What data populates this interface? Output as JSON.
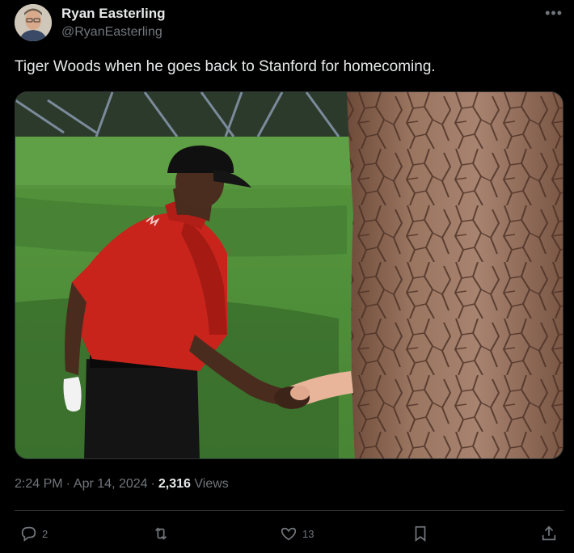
{
  "author": {
    "display_name": "Ryan Easterling",
    "handle": "@RyanEasterling"
  },
  "menu_icon": "more-horizontal-icon",
  "tweet": {
    "text": "Tiger Woods when he goes back to Stanford for homecoming."
  },
  "meta": {
    "time": "2:24 PM",
    "separator": "·",
    "date": "Apr 14, 2024",
    "views_count": "2,316",
    "views_label": "Views"
  },
  "actions": {
    "reply": {
      "icon": "reply-icon",
      "count": "2"
    },
    "retweet": {
      "icon": "retweet-icon",
      "count": ""
    },
    "like": {
      "icon": "heart-icon",
      "count": "13"
    },
    "bookmark": {
      "icon": "bookmark-icon",
      "count": ""
    },
    "share": {
      "icon": "share-icon",
      "count": ""
    }
  },
  "colors": {
    "background": "#000000",
    "text_primary": "#e7e9ea",
    "text_secondary": "#71767b",
    "divider": "#2f3336"
  }
}
